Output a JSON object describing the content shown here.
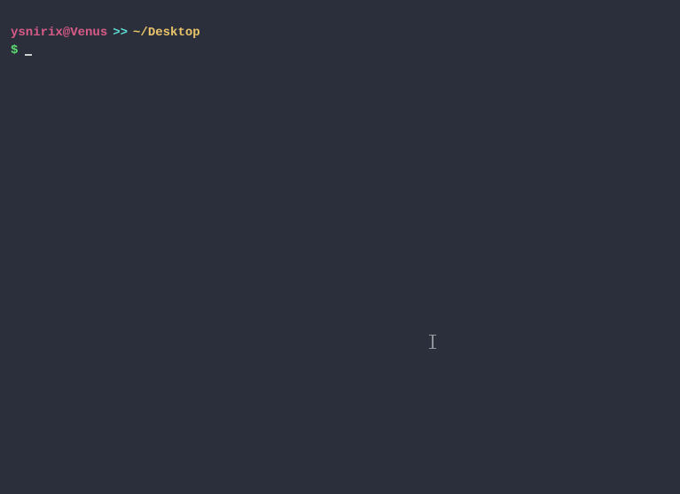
{
  "prompt": {
    "user_host": "ysnirix@Venus",
    "separator": ">>",
    "path": "~/Desktop",
    "symbol": "$"
  }
}
